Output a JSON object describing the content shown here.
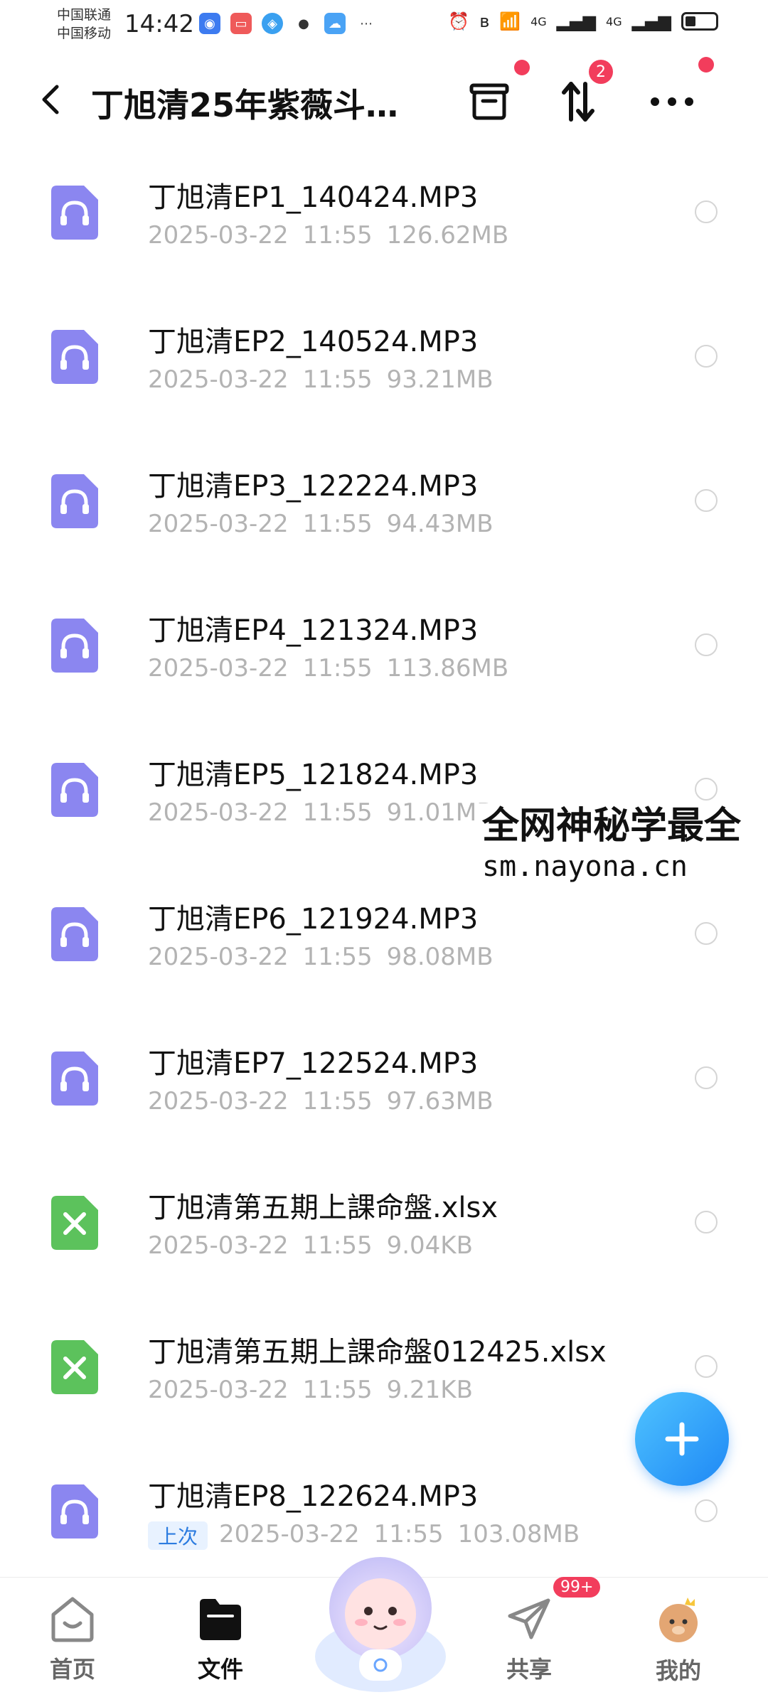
{
  "status_bar": {
    "carrier_1": "中国联通",
    "carrier_2": "中国移动",
    "time": "14:42",
    "signal_1": "4G",
    "signal_2": "4G"
  },
  "header": {
    "title": "丁旭清25年紫薇斗…",
    "sort_badge": "2"
  },
  "files": [
    {
      "name": "丁旭清EP1_140424.MP3",
      "date": "2025-03-22",
      "time": "11:55",
      "size": "126.62MB",
      "type": "audio"
    },
    {
      "name": "丁旭清EP2_140524.MP3",
      "date": "2025-03-22",
      "time": "11:55",
      "size": "93.21MB",
      "type": "audio"
    },
    {
      "name": "丁旭清EP3_122224.MP3",
      "date": "2025-03-22",
      "time": "11:55",
      "size": "94.43MB",
      "type": "audio"
    },
    {
      "name": "丁旭清EP4_121324.MP3",
      "date": "2025-03-22",
      "time": "11:55",
      "size": "113.86MB",
      "type": "audio"
    },
    {
      "name": "丁旭清EP5_121824.MP3",
      "date": "2025-03-22",
      "time": "11:55",
      "size": "91.01MB",
      "type": "audio"
    },
    {
      "name": "丁旭清EP6_121924.MP3",
      "date": "2025-03-22",
      "time": "11:55",
      "size": "98.08MB",
      "type": "audio"
    },
    {
      "name": "丁旭清EP7_122524.MP3",
      "date": "2025-03-22",
      "time": "11:55",
      "size": "97.63MB",
      "type": "audio"
    },
    {
      "name": "丁旭清第五期上課命盤.xlsx",
      "date": "2025-03-22",
      "time": "11:55",
      "size": "9.04KB",
      "type": "excel"
    },
    {
      "name": "丁旭清第五期上課命盤012425.xlsx",
      "date": "2025-03-22",
      "time": "11:55",
      "size": "9.21KB",
      "type": "excel"
    },
    {
      "name": "丁旭清EP8_122624.MP3",
      "date": "2025-03-22",
      "time": "11:55",
      "size": "103.08MB",
      "type": "audio",
      "tag": "上次"
    }
  ],
  "watermark": {
    "line1": "全网神秘学最全",
    "line2": "sm.nayona.cn"
  },
  "tab_bar": {
    "home": "首页",
    "files": "文件",
    "share": "共享",
    "share_badge": "99+",
    "mine": "我的"
  },
  "colors": {
    "audio_icon": "#8b86f0",
    "excel_icon": "#5cc25c",
    "accent": "#1e88f5",
    "badge": "#f23d5c"
  }
}
